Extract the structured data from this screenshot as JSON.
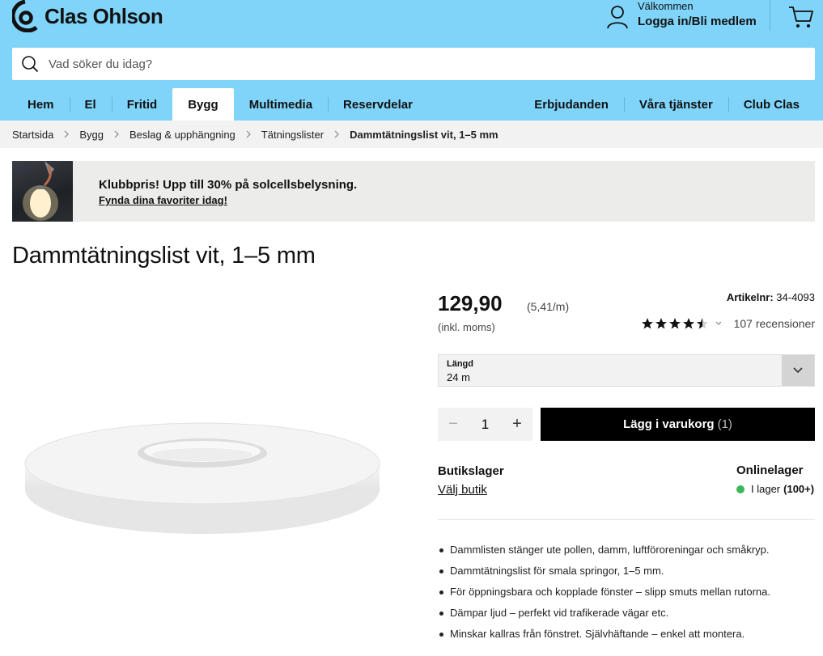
{
  "header": {
    "brand": "Clas Ohlson",
    "welcome": "Välkommen",
    "login_label": "Logga in/Bli medlem"
  },
  "search": {
    "placeholder": "Vad söker du idag?"
  },
  "nav": {
    "left_items": [
      "Hem",
      "El",
      "Fritid",
      "Bygg",
      "Multimedia",
      "Reservdelar"
    ],
    "active_item": "Bygg",
    "right_items": [
      "Erbjudanden",
      "Våra tjänster",
      "Club Clas"
    ]
  },
  "breadcrumb": [
    "Startsida",
    "Bygg",
    "Beslag & upphängning",
    "Tätningslister",
    "Dammtätningslist vit, 1–5 mm"
  ],
  "promo": {
    "title": "Klubbpris! Upp till 30% på solcellsbelysning.",
    "link": "Fynda dina favoriter idag!"
  },
  "product": {
    "title": "Dammtätningslist vit, 1–5 mm",
    "price": "129,90",
    "unit_price": "(5,41/m)",
    "vat_note": "(inkl. moms)",
    "article_label": "Artikelnr:",
    "article_number": "34-4093",
    "rating": 4.5,
    "reviews": "107 recensioner",
    "variant_label": "Längd",
    "variant_value": "24 m",
    "quantity": "1",
    "add_to_cart": "Lägg i varukorg",
    "cart_count": "(1)",
    "store_stock_title": "Butikslager",
    "store_link": "Välj butik",
    "online_stock_title": "Onlinelager",
    "online_status": "I lager",
    "online_count": "(100+)",
    "features": [
      "Dammlisten stänger ute pollen, damm, luftföroreningar och småkryp.",
      "Dammtätningslist för smala springor, 1–5 mm.",
      "För öppningsbara och kopplade fönster – slipp smuts mellan rutorna.",
      "Dämpar ljud – perfekt vid trafikerade vägar etc.",
      "Minskar kallras från fönstret. Självhäftande – enkel att montera."
    ]
  },
  "colors": {
    "header_bg": "#80d4f9",
    "cta_bg": "#000000",
    "stock_green": "#3cb85c"
  },
  "icons": [
    "logo-mark-icon",
    "user-icon",
    "cart-icon",
    "search-icon",
    "chevron-right-icon",
    "star-icon",
    "chevron-down-icon"
  ]
}
